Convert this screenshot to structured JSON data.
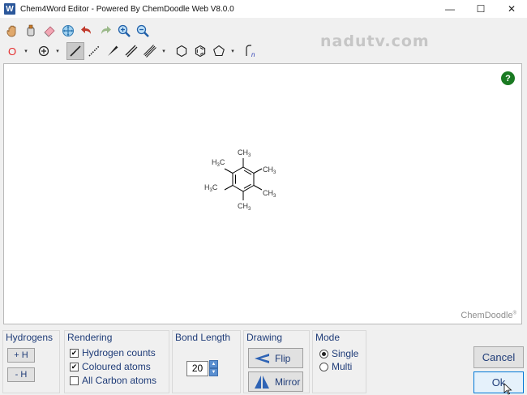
{
  "window": {
    "title": "Chem4Word Editor - Powered By ChemDoodle Web V8.0.0",
    "app_icon": "W",
    "minimize_glyph": "—",
    "maximize_glyph": "☐",
    "close_glyph": "✕"
  },
  "toolbar": {
    "row1_icons": [
      "hand-icon",
      "lasso-icon",
      "eraser-icon",
      "center-icon",
      "undo-icon",
      "redo-icon",
      "zoom-in-icon",
      "zoom-out-icon"
    ],
    "row2": {
      "atom_label": "O",
      "drop_glyph": "▾"
    }
  },
  "watermark": "nadutv.com",
  "canvas": {
    "help_label": "?",
    "logo_text": "ChemDoodle",
    "logo_mark": "®"
  },
  "molecule": {
    "name_icon": "hexamethylbenzene-structure",
    "labels": [
      "CH3",
      "CH3",
      "CH3",
      "CH3",
      "H3C",
      "H3C"
    ]
  },
  "hydrogens": {
    "title": "Hydrogens",
    "add_label": "+ H",
    "remove_label": "- H"
  },
  "rendering": {
    "title": "Rendering",
    "options": [
      {
        "label": "Hydrogen counts",
        "checked": true
      },
      {
        "label": "Coloured atoms",
        "checked": true
      },
      {
        "label": "All Carbon atoms",
        "checked": false
      }
    ],
    "check_glyph": "✔"
  },
  "bond_length": {
    "title": "Bond Length",
    "value": "20",
    "up_glyph": "▲",
    "down_glyph": "▼"
  },
  "drawing": {
    "title": "Drawing",
    "flip_label": "Flip",
    "mirror_label": "Mirror"
  },
  "mode": {
    "title": "Mode",
    "options": [
      {
        "label": "Single",
        "selected": true
      },
      {
        "label": "Multi",
        "selected": false
      }
    ]
  },
  "actions": {
    "cancel_label": "Cancel",
    "ok_label": "Ok"
  },
  "colors": {
    "accent_text": "#1f3c78",
    "help_green": "#1a7a22",
    "primary_border": "#0078d7"
  }
}
